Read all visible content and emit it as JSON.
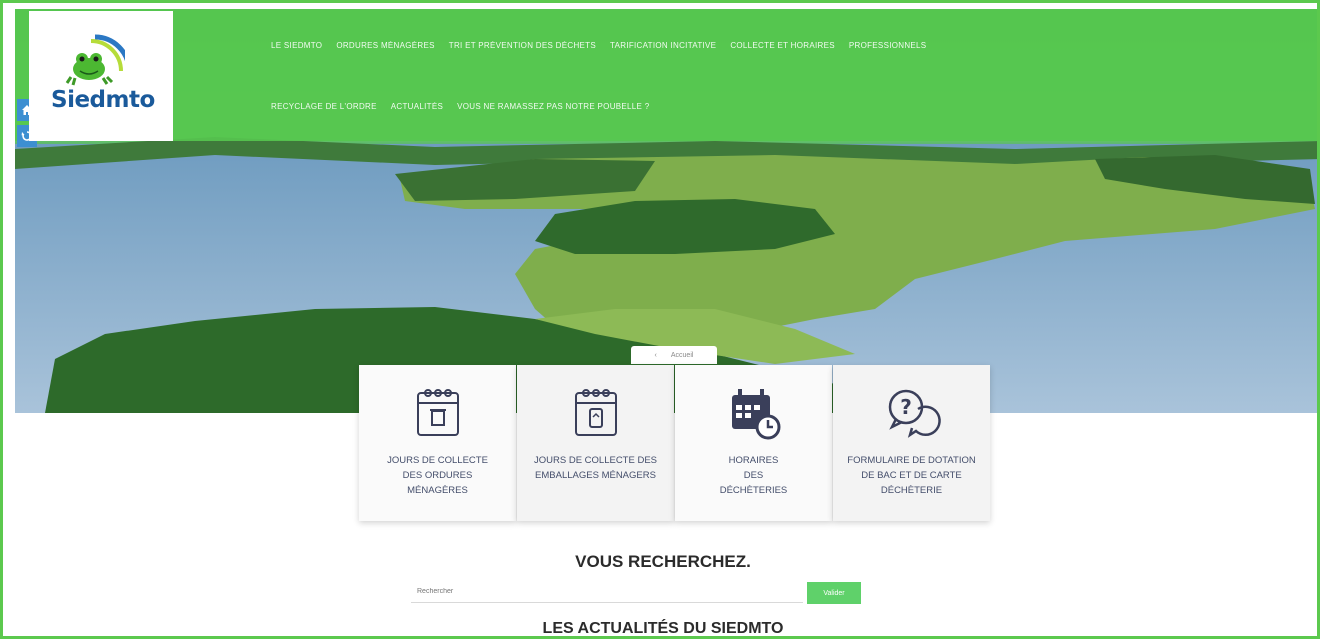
{
  "logo": {
    "text": "Siedmto"
  },
  "nav": {
    "row1": [
      "Le Siedmto",
      "Ordures ménagères",
      "Tri et prévention des déchets",
      "Tarification incitative",
      "Collecte et horaires",
      "Professionnels"
    ],
    "row2": [
      "Recyclage de l'ordre",
      "Actualités",
      "Vous ne ramassez pas notre poubelle ?"
    ]
  },
  "side_buttons": [
    "home-icon",
    "refresh-icon"
  ],
  "breadcrumb_tab": {
    "text": "Accueil"
  },
  "cards": [
    {
      "label": "Jours de collecte\ndes ordures\nménagères",
      "icon": "calendar-trash-icon"
    },
    {
      "label": "Jours de collecte des\nemballages ménagers",
      "icon": "calendar-recycle-icon"
    },
    {
      "label": "Horaires\ndes\ndéchèteries",
      "icon": "calendar-clock-icon"
    },
    {
      "label": "Formulaire de dotation\nde bac et de carte\ndéchèterie",
      "icon": "question-chat-icon"
    }
  ],
  "search": {
    "title": "VOUS RECHERCHEZ.",
    "placeholder": "Rechercher",
    "button": "Valider"
  },
  "news": {
    "title": "LES ACTUALITÉS DU SIEDMTO"
  },
  "colors": {
    "brand_green": "#5cc94e",
    "button_green": "#5fd16a",
    "logo_blue": "#1a5a9b",
    "side_blue": "#3d8fd1"
  }
}
